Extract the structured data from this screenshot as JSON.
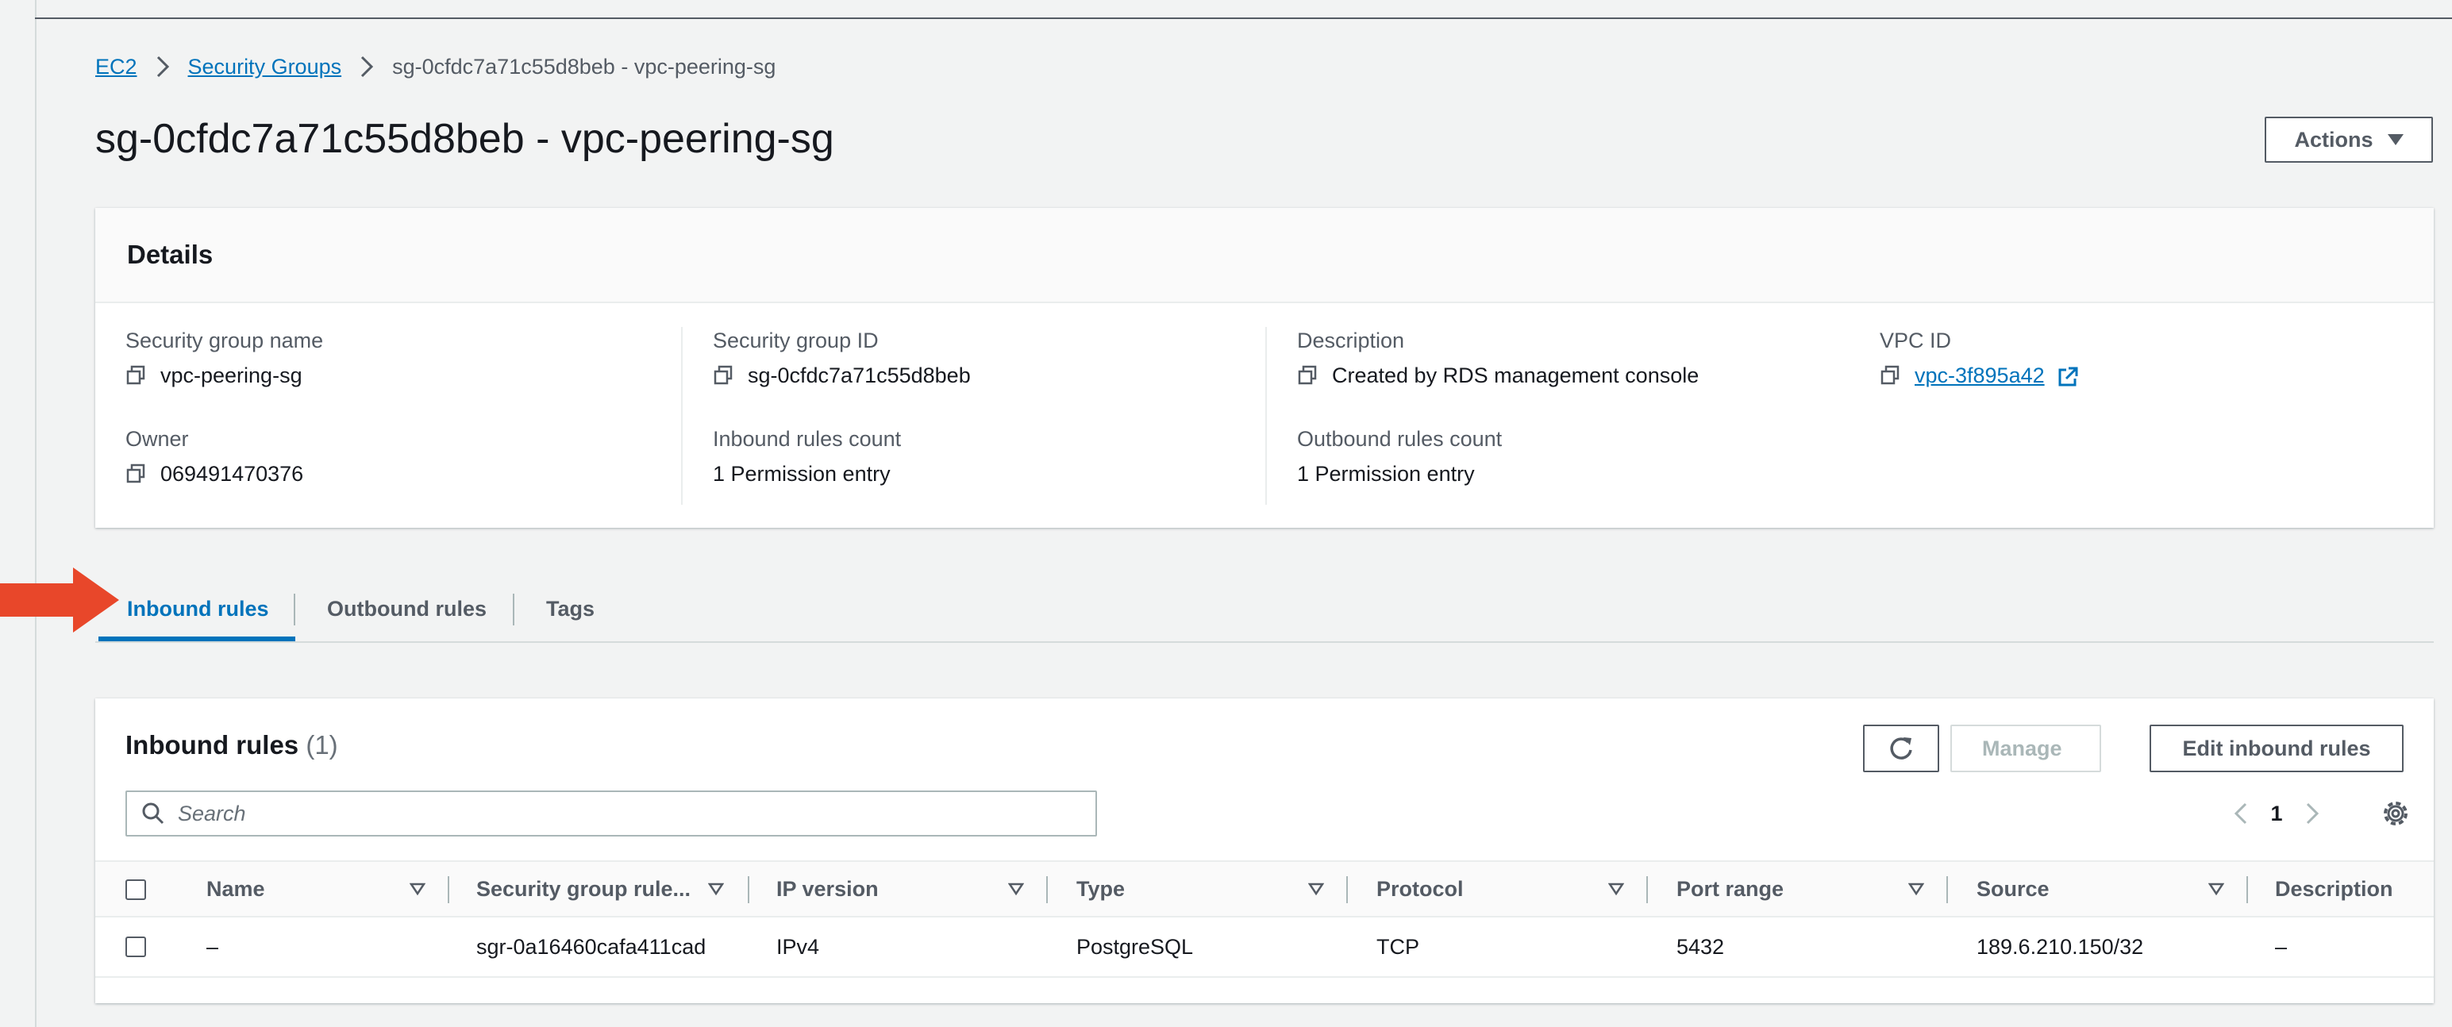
{
  "breadcrumb": {
    "items": [
      "EC2",
      "Security Groups"
    ],
    "current": "sg-0cfdc7a71c55d8beb - vpc-peering-sg"
  },
  "page": {
    "title": "sg-0cfdc7a71c55d8beb - vpc-peering-sg",
    "actions_label": "Actions"
  },
  "details": {
    "heading": "Details",
    "fields": [
      {
        "label": "Security group name",
        "value": "vpc-peering-sg"
      },
      {
        "label": "Security group ID",
        "value": "sg-0cfdc7a71c55d8beb"
      },
      {
        "label": "Description",
        "value": "Created by RDS management console"
      },
      {
        "label": "VPC ID",
        "value": "vpc-3f895a42"
      },
      {
        "label": "Owner",
        "value": "069491470376"
      },
      {
        "label": "Inbound rules count",
        "value": "1 Permission entry"
      },
      {
        "label": "Outbound rules count",
        "value": "1 Permission entry"
      }
    ]
  },
  "tabs": [
    "Inbound rules",
    "Outbound rules",
    "Tags"
  ],
  "active_tab": "Inbound rules",
  "rules": {
    "title": "Inbound rules",
    "count": "(1)",
    "manage_label": "Manage",
    "edit_label": "Edit inbound rules",
    "search_placeholder": "Search",
    "page": "1",
    "columns": [
      "Name",
      "Security group rule...",
      "IP version",
      "Type",
      "Protocol",
      "Port range",
      "Source",
      "Description"
    ],
    "rows": [
      [
        "–",
        "sgr-0a16460cafa411cad",
        "IPv4",
        "PostgreSQL",
        "TCP",
        "5432",
        "189.6.210.150/32",
        "–"
      ]
    ]
  },
  "colors": {
    "link": "#0073bb",
    "annotation_arrow": "#e8472a",
    "text": "#16191f",
    "muted": "#545b64"
  },
  "icons": [
    "chevron-right-icon",
    "caret-down-icon",
    "copy-icon",
    "external-link-icon",
    "refresh-icon",
    "search-icon",
    "chevron-left-icon",
    "gear-icon",
    "sort-icon",
    "arrow-annotation"
  ]
}
